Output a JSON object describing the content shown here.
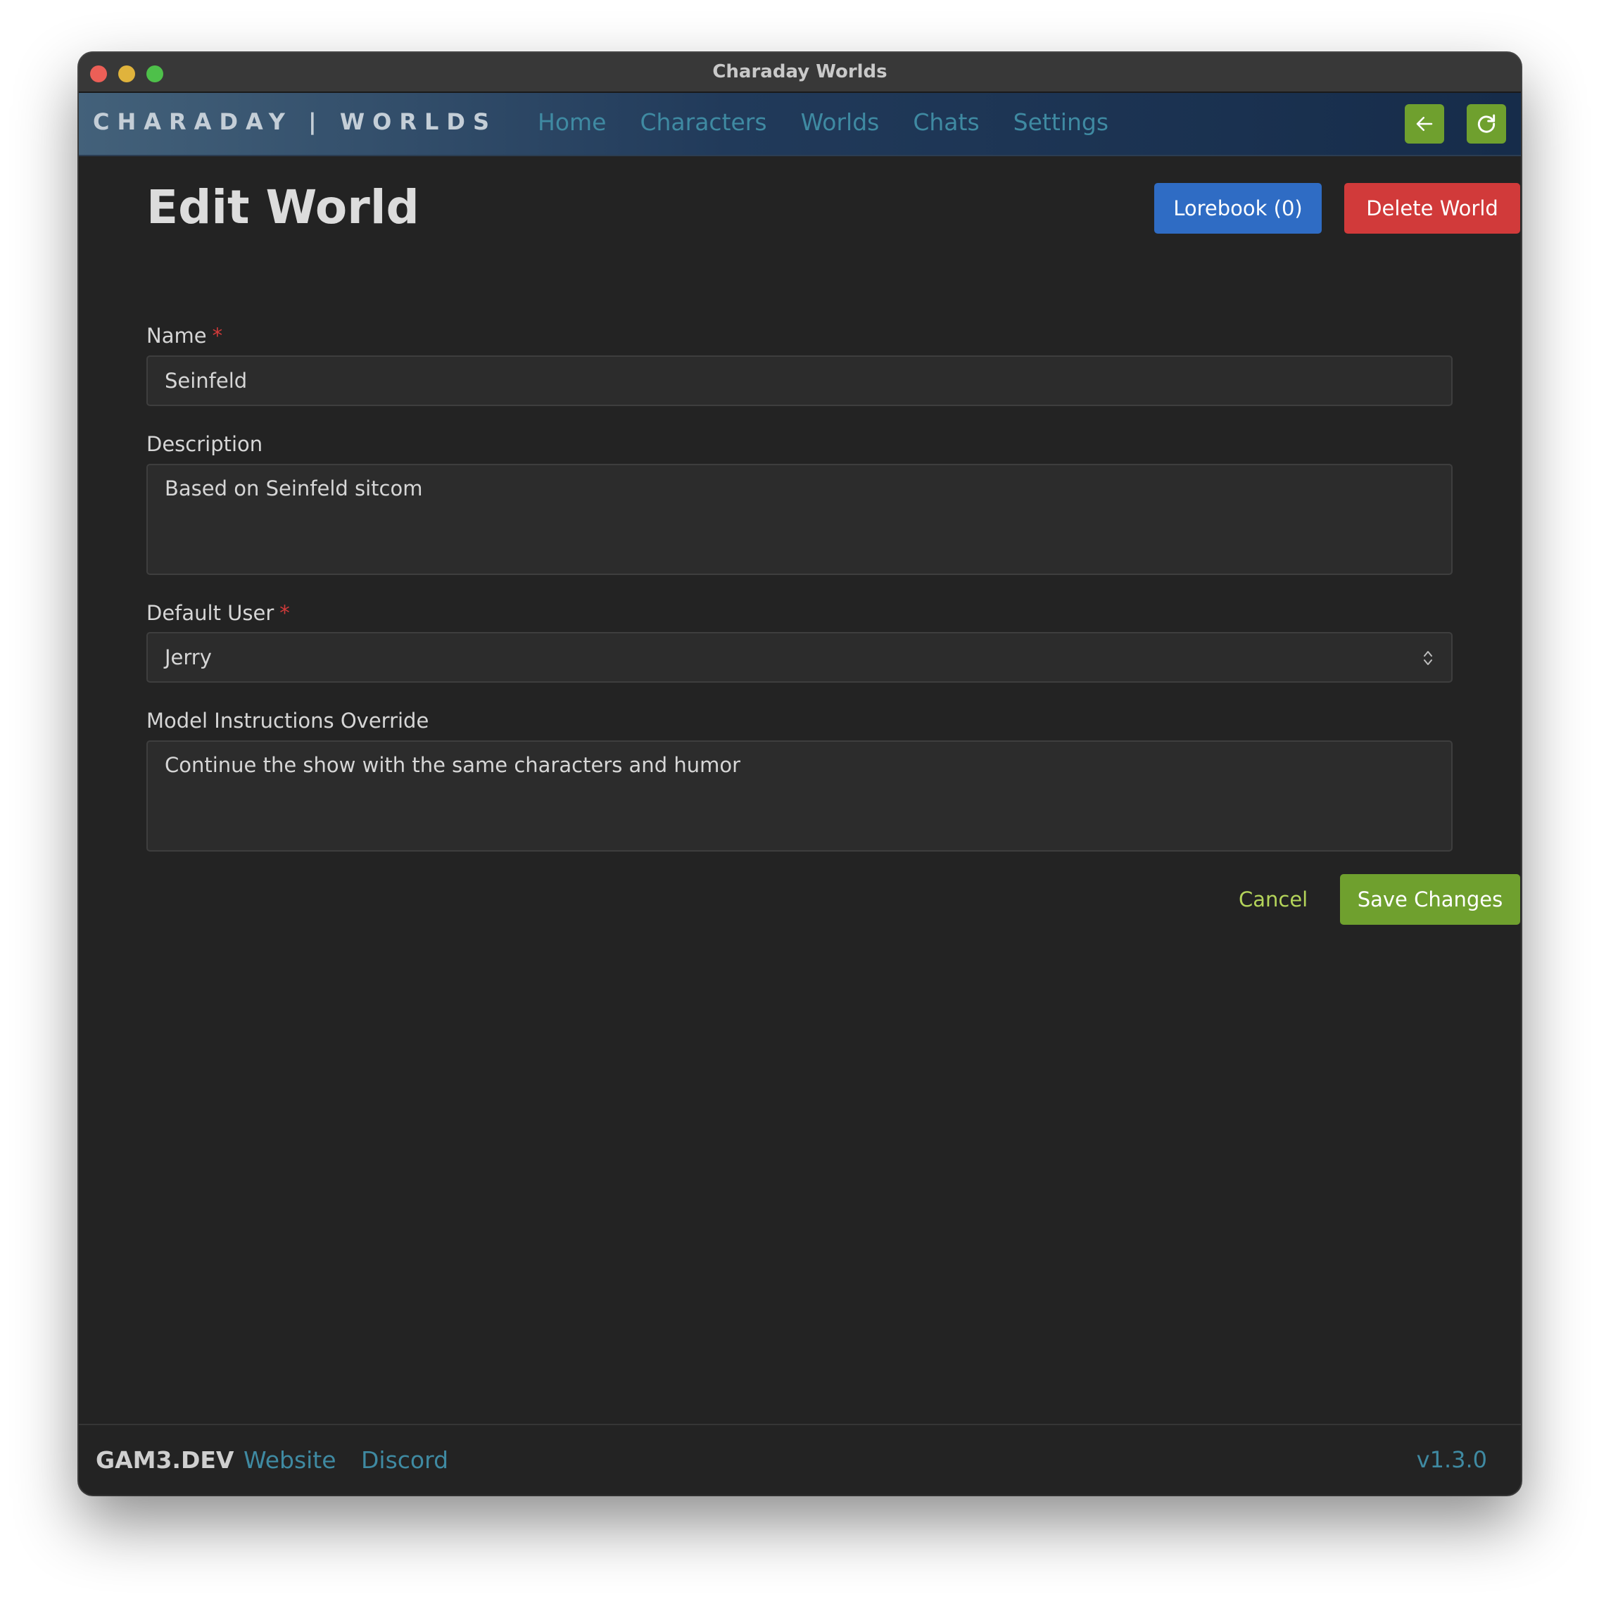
{
  "window": {
    "title": "Charaday Worlds"
  },
  "nav": {
    "brand": "CHARADAY | WORLDS",
    "links": [
      {
        "label": "Home"
      },
      {
        "label": "Characters"
      },
      {
        "label": "Worlds"
      },
      {
        "label": "Chats"
      },
      {
        "label": "Settings"
      }
    ],
    "back_icon": "arrow-left-icon",
    "refresh_icon": "refresh-icon"
  },
  "page": {
    "title": "Edit World",
    "lorebook_label": "Lorebook (0)",
    "delete_label": "Delete World"
  },
  "form": {
    "name": {
      "label": "Name",
      "required_mark": "*",
      "value": "Seinfeld"
    },
    "description": {
      "label": "Description",
      "value": "Based on Seinfeld sitcom"
    },
    "default_user": {
      "label": "Default User",
      "required_mark": "*",
      "value": "Jerry"
    },
    "model_instructions": {
      "label": "Model Instructions Override",
      "value": "Continue the show with the same characters and humor"
    },
    "cancel_label": "Cancel",
    "save_label": "Save Changes"
  },
  "footer": {
    "brand": "GAM3.DEV",
    "website_label": "Website",
    "discord_label": "Discord",
    "version": "v1.3.0"
  },
  "colors": {
    "accent_green": "#6fa02e",
    "primary_blue": "#2f6cc4",
    "danger_red": "#d13a3a",
    "link_teal": "#3f8aa2"
  }
}
